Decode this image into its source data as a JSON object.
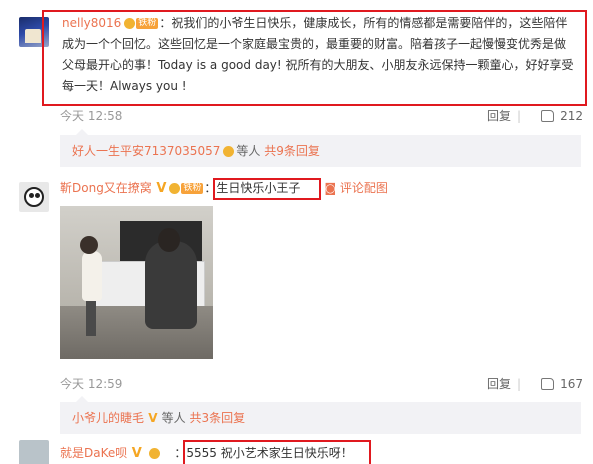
{
  "comment1": {
    "username": "nelly8016",
    "badge_label": "铁粉",
    "text": "：祝我们的小爷生日快乐，健康成长，所有的情感都是需要陪伴的，这些陪伴成为一个个回忆。这些回忆是一个家庭最宝贵的，最重要的财富。陪着孩子一起慢慢变优秀是做父母最开心的事！Today is a good day! 祝所有的大朋友、小朋友永远保持一颗童心，好好享受每一天！Always you !",
    "time": "今天 12:58",
    "reply_label": "回复",
    "like_count": "212",
    "sub_user": "好人一生平安7137035057",
    "sub_and": "等人",
    "sub_count": "共9条回复"
  },
  "comment2": {
    "username": "靳Dong又在撩窝",
    "badge_label": "铁粉",
    "text": "：生日快乐小王子",
    "extra": "评论配图",
    "time": "今天 12:59",
    "reply_label": "回复",
    "like_count": "167",
    "sub_user": "小爷儿的睫毛",
    "sub_and": "等人",
    "sub_count": "共3条回复"
  },
  "comment3": {
    "username": "就是DaKe呗",
    "text": "：5555 祝小艺术家生日快乐呀！"
  },
  "colors": {
    "username": "#eb7350",
    "highlight_box": "#e0191f",
    "subbox_bg": "#f2f2f5"
  },
  "icons": [
    "thumbs-up-icon",
    "camera-icon",
    "fan-badge-icon",
    "verified-v-icon"
  ]
}
